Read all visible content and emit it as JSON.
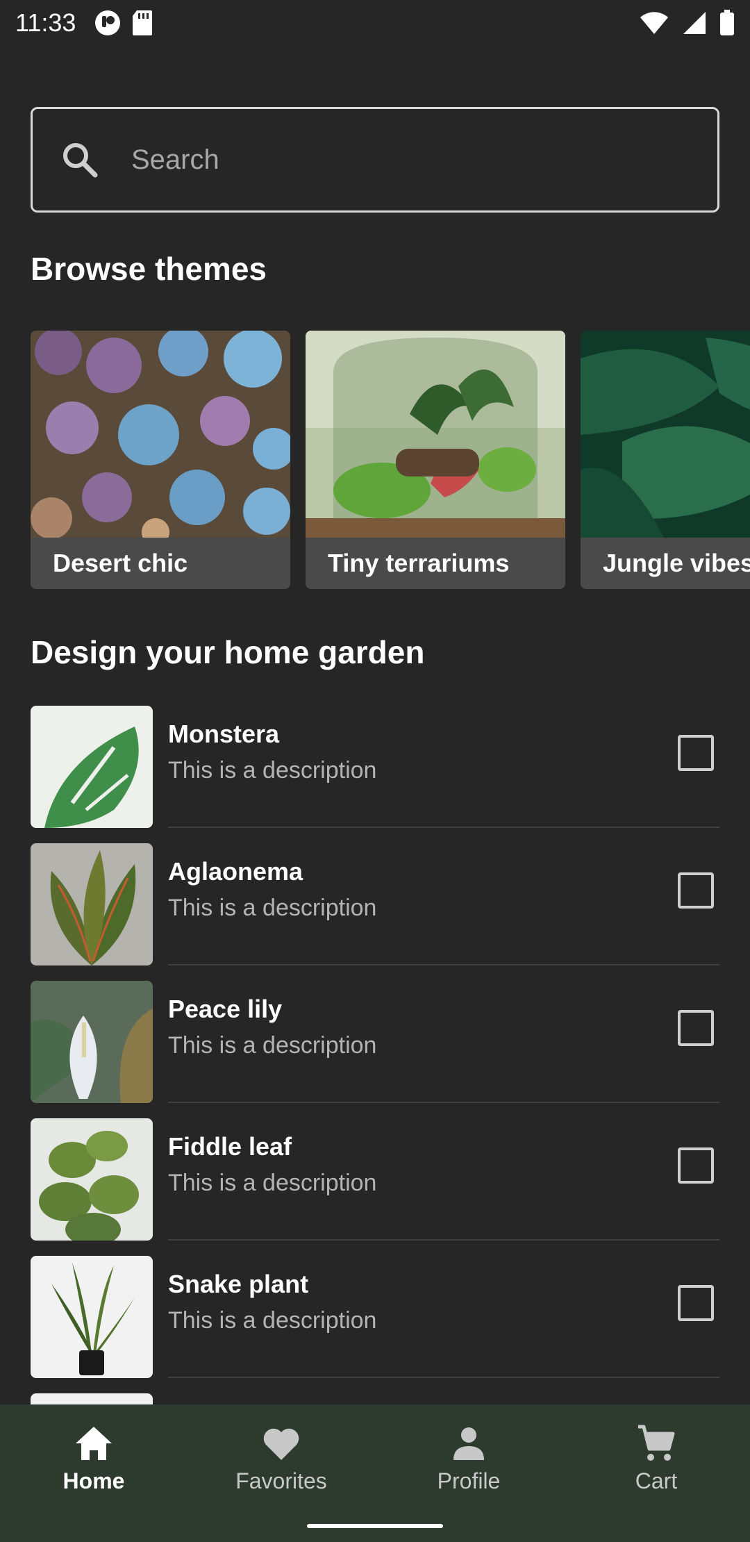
{
  "status_bar": {
    "time": "11:33"
  },
  "search": {
    "placeholder": "Search"
  },
  "themes": {
    "title": "Browse themes",
    "items": [
      {
        "label": "Desert chic"
      },
      {
        "label": "Tiny terrariums"
      },
      {
        "label": "Jungle vibes"
      }
    ]
  },
  "garden": {
    "title": "Design your home garden",
    "items": [
      {
        "name": "Monstera",
        "description": "This is a description",
        "checked": false
      },
      {
        "name": "Aglaonema",
        "description": "This is a description",
        "checked": false
      },
      {
        "name": "Peace lily",
        "description": "This is a description",
        "checked": false
      },
      {
        "name": "Fiddle leaf",
        "description": "This is a description",
        "checked": false
      },
      {
        "name": "Snake plant",
        "description": "This is a description",
        "checked": false
      }
    ]
  },
  "bottom_nav": {
    "items": [
      {
        "label": "Home",
        "icon": "home-icon",
        "active": true
      },
      {
        "label": "Favorites",
        "icon": "heart-icon",
        "active": false
      },
      {
        "label": "Profile",
        "icon": "person-icon",
        "active": false
      },
      {
        "label": "Cart",
        "icon": "cart-icon",
        "active": false
      }
    ]
  },
  "colors": {
    "background": "#262626",
    "nav_background": "#2d3a2e",
    "label_bar": "#4a4a4a"
  }
}
